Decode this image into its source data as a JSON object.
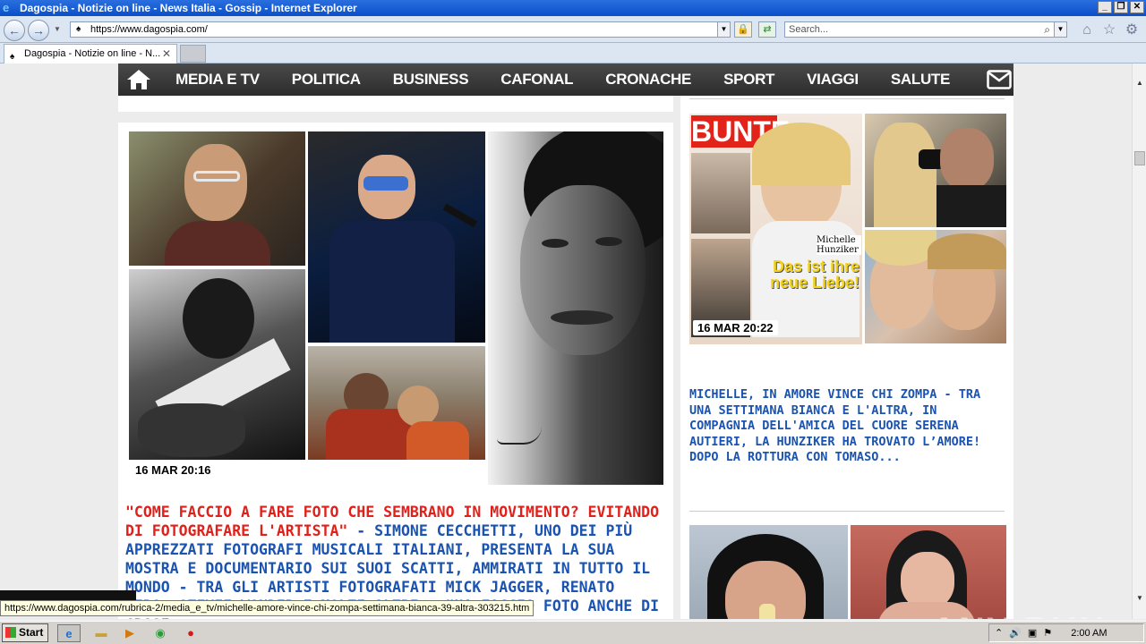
{
  "window": {
    "title": "Dagospia - Notizie on line - News Italia - Gossip - Internet Explorer",
    "address": "https://www.dagospia.com/",
    "search_placeholder": "Search...",
    "tab_title": "Dagospia - Notizie on line - N..."
  },
  "nav": {
    "items": [
      "MEDIA E TV",
      "POLITICA",
      "BUSINESS",
      "CAFONAL",
      "CRONACHE",
      "SPORT",
      "VIAGGI",
      "SALUTE"
    ]
  },
  "main_article": {
    "timestamp": "16 MAR 20:16",
    "headline_red": "\"COME FACCIO A FARE FOTO CHE SEMBRANO IN MOVIMENTO? EVITANDO DI FOTOGRAFARE L'ARTISTA\"",
    "headline_blue": " - SIMONE CECCHETTI, UNO DEI PIÙ APPREZZATI FOTOGRAFI MUSICALI ITALIANI, PRESENTA LA SUA MOSTRA E DOCUMENTARIO SUI SUOI SCATTI, AMMIRATI IN TUTTO IL MONDO - TRA GLI ARTISTI FOTOGRAFATI MICK JAGGER, RENATO ZERO, STEVIE WONDER E MOLTI ALTRI - \"HA FACCIO FOTO ANCHE DI GROSI"
  },
  "side_article": {
    "timestamp": "16 MAR 20:22",
    "magazine": {
      "name": "BUNTE",
      "cover_name": "Michelle Hunziker",
      "cover_headline": "Das ist ihre neue Liebe!"
    },
    "headline": "MICHELLE, IN AMORE VINCE CHI ZOMPA - TRA UNA SETTIMANA BIANCA E L'ALTRA, IN COMPAGNIA DELL'AMICA DEL CUORE SERENA AUTIERI, LA HUNZIKER HA TROVATO L’AMORE! DOPO LA ROTTURA CON TOMASO..."
  },
  "statusbar": {
    "url": "https://www.dagospia.com/rubrica-2/media_e_tv/michelle-amore-vince-chi-zompa-settimana-bianca-39-altra-303215.htm"
  },
  "taskbar": {
    "start_label": "Start",
    "clock": "2:00 AM"
  },
  "watermark": "ANY RUN"
}
